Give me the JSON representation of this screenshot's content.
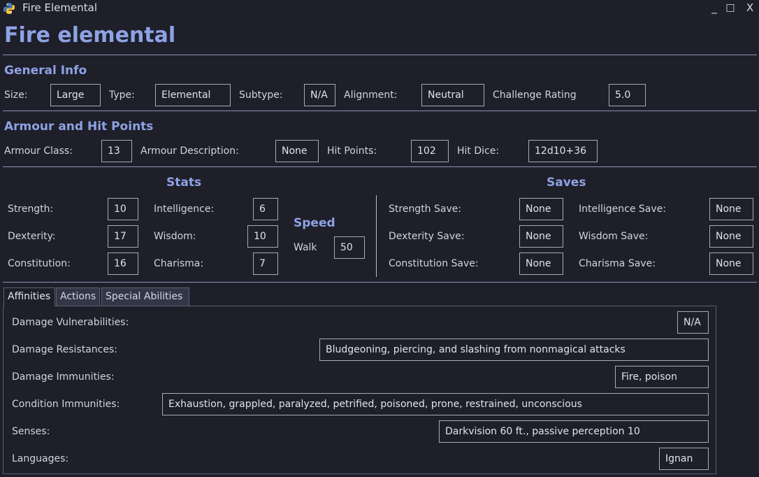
{
  "window": {
    "title": "Fire Elemental",
    "minimize": "_",
    "maximize": "□",
    "close": "X"
  },
  "page_title": "Fire elemental",
  "general": {
    "heading": "General Info",
    "size_label": "Size:",
    "size": "Large",
    "type_label": "Type:",
    "type": "Elemental",
    "subtype_label": "Subtype:",
    "subtype": "N/A",
    "alignment_label": "Alignment:",
    "alignment": "Neutral",
    "cr_label": "Challenge Rating",
    "cr": "5.0"
  },
  "armour": {
    "heading": "Armour and Hit Points",
    "ac_label": "Armour Class:",
    "ac": "13",
    "desc_label": "Armour Description:",
    "desc": "None",
    "hp_label": "Hit Points:",
    "hp": "102",
    "dice_label": "Hit Dice:",
    "dice": "12d10+36"
  },
  "stats": {
    "heading": "Stats",
    "str_label": "Strength:",
    "str": "10",
    "dex_label": "Dexterity:",
    "dex": "17",
    "con_label": "Constitution:",
    "con": "16",
    "int_label": "Intelligence:",
    "int": "6",
    "wis_label": "Wisdom:",
    "wis": "10",
    "cha_label": "Charisma:",
    "cha": "7"
  },
  "speed": {
    "heading": "Speed",
    "walk_label": "Walk",
    "walk": "50"
  },
  "saves": {
    "heading": "Saves",
    "str_label": "Strength Save:",
    "str": "None",
    "dex_label": "Dexterity Save:",
    "dex": "None",
    "con_label": "Constitution Save:",
    "con": "None",
    "int_label": "Intelligence Save:",
    "int": "None",
    "wis_label": "Wisdom Save:",
    "wis": "None",
    "cha_label": "Charisma Save:",
    "cha": "None"
  },
  "tabs": [
    {
      "label": "Affinities"
    },
    {
      "label": "Actions"
    },
    {
      "label": "Special Abilities"
    }
  ],
  "affinities": {
    "vuln_label": "Damage Vulnerabilities:",
    "vuln": "N/A",
    "resist_label": "Damage Resistances:",
    "resist": "Bludgeoning, piercing, and slashing from nonmagical attacks",
    "immune_label": "Damage Immunities:",
    "immune": "Fire, poison",
    "cond_label": "Condition Immunities:",
    "cond": "Exhaustion, grappled, paralyzed, petrified, poisoned, prone, restrained, unconscious",
    "senses_label": "Senses:",
    "senses": "Darkvision 60 ft., passive perception 10",
    "lang_label": "Languages:",
    "lang": "Ignan"
  },
  "colors": {
    "accent": "#8ea2e4",
    "background": "#1e1f29",
    "border": "#a9abb4"
  },
  "icons": {
    "app": "python-logo-icon"
  }
}
